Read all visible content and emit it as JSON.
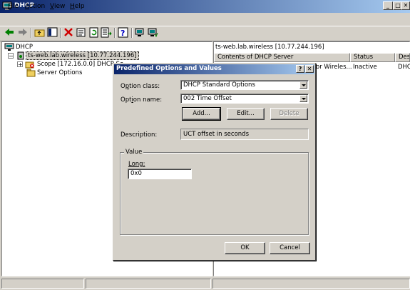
{
  "window": {
    "title": "DHCP",
    "min_glyph": "_",
    "max_glyph": "□",
    "close_glyph": "✕"
  },
  "menu": [
    {
      "label": "File",
      "accel": "F",
      "rest": "ile"
    },
    {
      "label": "Action",
      "accel": "A",
      "rest": "ction"
    },
    {
      "label": "View",
      "accel": "V",
      "rest": "iew"
    },
    {
      "label": "Help",
      "accel": "H",
      "rest": "elp"
    }
  ],
  "tree": {
    "root": "DHCP",
    "server": "ts-web.lab.wireless [10.77.244.196]",
    "scope": "Scope [172.16.0.0] DHCP Se",
    "server_options": "Server Options",
    "expand_glyph": "+",
    "collapse_glyph": "−"
  },
  "right_pane": {
    "header_title": "ts-web.lab.wireless [10.77.244.196]",
    "columns": [
      "Contents of DHCP Server",
      "Status",
      "Desc"
    ],
    "row": {
      "name": "or Wireles...",
      "status": "Inactive",
      "desc": "DHC"
    }
  },
  "dialog": {
    "title": "Predefined Options and Values",
    "help_glyph": "?",
    "close_glyph": "✕",
    "option_class_label_pre": "O",
    "option_class_label_accel": "p",
    "option_class_label_post": "tion class:",
    "option_class_value": "DHCP Standard Options",
    "option_name_label_pre": "Opt",
    "option_name_label_accel": "i",
    "option_name_label_post": "on name:",
    "option_name_value": "002 Time Offset",
    "add_label": "Add...",
    "edit_label": "Edit...",
    "delete_label": "Delete",
    "description_label": "Description:",
    "description_value": "UCT offset in seconds",
    "value_group_label": "Value",
    "long_label": "Long:",
    "long_value": "0x0",
    "ok_label": "OK",
    "cancel_label": "Cancel"
  },
  "colors": {
    "title_active": "#0a246a",
    "face": "#d4d0c8"
  }
}
